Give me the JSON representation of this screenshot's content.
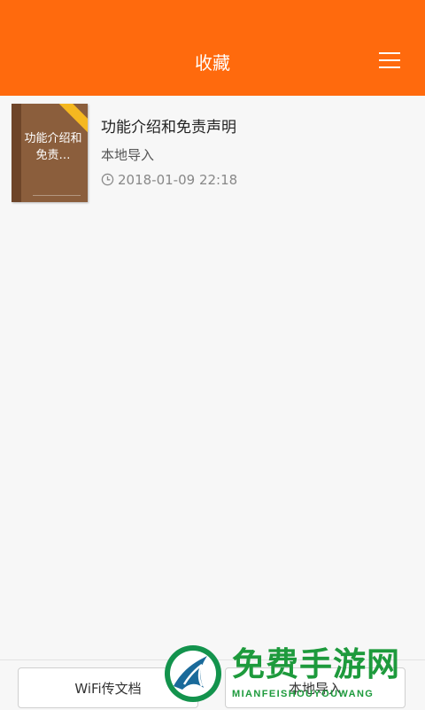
{
  "header": {
    "title": "收藏",
    "menu_icon": "menu-icon"
  },
  "book": {
    "cover_title": "功能介绍和免责…",
    "name": "功能介绍和免责声明",
    "source": "本地导入",
    "time": "2018-01-09 22:18",
    "time_icon": "clock-icon"
  },
  "bottom": {
    "wifi_label": "WiFi传文档",
    "local_label": "本地导入"
  },
  "watermark": {
    "name": "免费手游网",
    "pinyin": "MIANFEISHOUYOUWANG"
  },
  "colors": {
    "accent": "#ff6a0d",
    "cover": "#8b5e3c",
    "watermark": "#1d9a3c"
  }
}
